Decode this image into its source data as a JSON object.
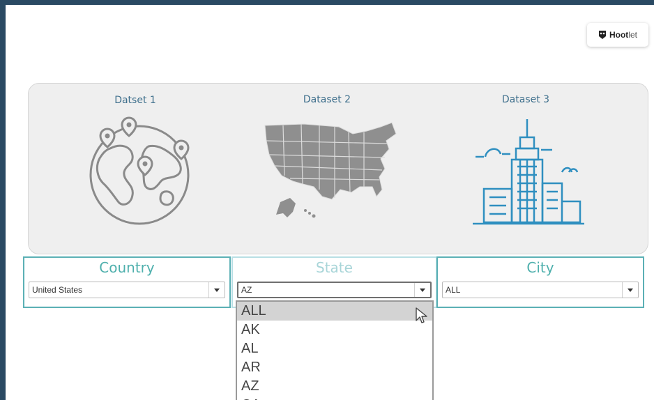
{
  "hootlet": {
    "brand": "Hoot",
    "brand_suffix": "let",
    "icon": "hootlet-logo-icon"
  },
  "datasets": [
    {
      "title": "Datset 1",
      "icon": "globe-pins-icon"
    },
    {
      "title": "Dataset 2",
      "icon": "us-map-icon"
    },
    {
      "title": "Dataset 3",
      "icon": "city-skyline-icon"
    }
  ],
  "filters": {
    "country": {
      "label": "Country",
      "value": "United States"
    },
    "state": {
      "label": "State",
      "value": "AZ"
    },
    "city": {
      "label": "City",
      "value": "ALL"
    }
  },
  "state_dropdown": {
    "options": [
      "ALL",
      "AK",
      "AL",
      "AR",
      "AZ",
      "CA"
    ],
    "highlighted": "ALL"
  },
  "colors": {
    "teal_border": "#5bb0b5",
    "teal_label": "#4fb0ad",
    "title_blue": "#3e6f8c",
    "icon_gray": "#8a8a8a",
    "icon_blue": "#2f8fc0"
  }
}
